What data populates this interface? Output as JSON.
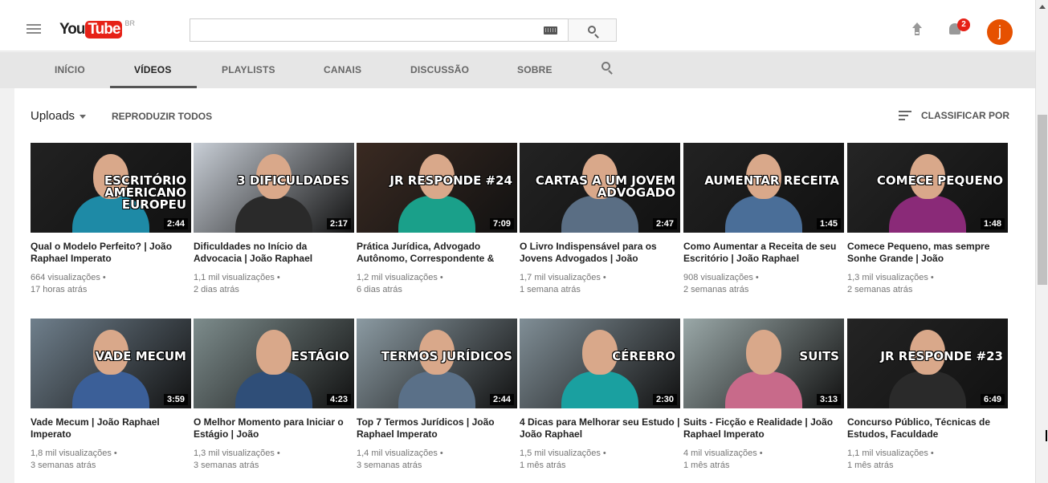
{
  "header": {
    "logo_you": "You",
    "logo_tube": "Tube",
    "country": "BR",
    "search_placeholder": "",
    "notification_count": "2",
    "avatar_letter": "j"
  },
  "tabs": [
    {
      "label": "INÍCIO",
      "active": false
    },
    {
      "label": "VÍDEOS",
      "active": true
    },
    {
      "label": "PLAYLISTS",
      "active": false
    },
    {
      "label": "CANAIS",
      "active": false
    },
    {
      "label": "DISCUSSÃO",
      "active": false
    },
    {
      "label": "SOBRE",
      "active": false
    }
  ],
  "toolbar": {
    "uploads_label": "Uploads",
    "play_all_label": "REPRODUZIR TODOS",
    "sort_label": "CLASSIFICAR POR"
  },
  "videos": [
    {
      "title": "Qual o Modelo Perfeito? | João Raphael Imperato",
      "views": "664 visualizações •",
      "age": "17 horas atrás",
      "duration": "2:44",
      "overlay": "ESCRITÓRIO AMERICANO EUROPEU",
      "theme": "#222",
      "shirt": "#1e8aa6"
    },
    {
      "title": "Dificuldades no Início da Advocacia | João Raphael",
      "views": "1,1 mil visualizações •",
      "age": "2 dias atrás",
      "duration": "2:17",
      "overlay": "3 DIFICULDADES",
      "theme": "#c8ced6",
      "shirt": "#2a2a2a"
    },
    {
      "title": "Prática Jurídica, Advogado Autônomo, Correspondente &",
      "views": "1,2 mil visualizações •",
      "age": "6 dias atrás",
      "duration": "7:09",
      "overlay": "JR RESPONDE #24",
      "theme": "#3a2a22",
      "shirt": "#1aa08a"
    },
    {
      "title": "O Livro Indispensável para os Jovens Advogados | João",
      "views": "1,7 mil visualizações •",
      "age": "1 semana atrás",
      "duration": "2:47",
      "overlay": "CARTAS A UM JOVEM ADVOGADO",
      "theme": "#232323",
      "shirt": "#5a6e84"
    },
    {
      "title": "Como Aumentar a Receita de seu Escritório | João Raphael",
      "views": "908 visualizações •",
      "age": "2 semanas atrás",
      "duration": "1:45",
      "overlay": "AUMENTAR RECEITA",
      "theme": "#222",
      "shirt": "#4a6e98"
    },
    {
      "title": "Comece Pequeno, mas sempre Sonhe Grande | João",
      "views": "1,3 mil visualizações •",
      "age": "2 semanas atrás",
      "duration": "1:48",
      "overlay": "COMECE PEQUENO",
      "theme": "#252525",
      "shirt": "#8a2a78"
    },
    {
      "title": "Vade Mecum | João Raphael Imperato",
      "views": "1,8 mil visualizações •",
      "age": "3 semanas atrás",
      "duration": "3:59",
      "overlay": "VADE MECUM",
      "theme": "#6f7f8c",
      "shirt": "#3b5f98"
    },
    {
      "title": "O Melhor Momento para Iniciar o Estágio | João",
      "views": "1,3 mil visualizações •",
      "age": "3 semanas atrás",
      "duration": "4:23",
      "overlay": "ESTÁGIO",
      "theme": "#7d8c8c",
      "shirt": "#2f4e78"
    },
    {
      "title": "Top 7 Termos Jurídicos | João Raphael Imperato",
      "views": "1,4 mil visualizações •",
      "age": "3 semanas atrás",
      "duration": "2:44",
      "overlay": "TERMOS JURÍDICOS",
      "theme": "#8b9aa2",
      "shirt": "#5a7088"
    },
    {
      "title": "4 Dicas para Melhorar seu Estudo | João Raphael",
      "views": "1,5 mil visualizações •",
      "age": "1 mês atrás",
      "duration": "2:30",
      "overlay": "CÉREBRO",
      "theme": "#808e96",
      "shirt": "#1aa0a0"
    },
    {
      "title": "Suits - Ficção e Realidade | João Raphael Imperato",
      "views": "4 mil visualizações •",
      "age": "1 mês atrás",
      "duration": "3:13",
      "overlay": "SUITS",
      "theme": "#9aa8a8",
      "shirt": "#c86a8a"
    },
    {
      "title": "Concurso Público, Técnicas de Estudos, Faculdade",
      "views": "1,1 mil visualizações •",
      "age": "1 mês atrás",
      "duration": "6:49",
      "overlay": "JR RESPONDE #23",
      "theme": "#242424",
      "shirt": "#2a2a2a"
    }
  ]
}
